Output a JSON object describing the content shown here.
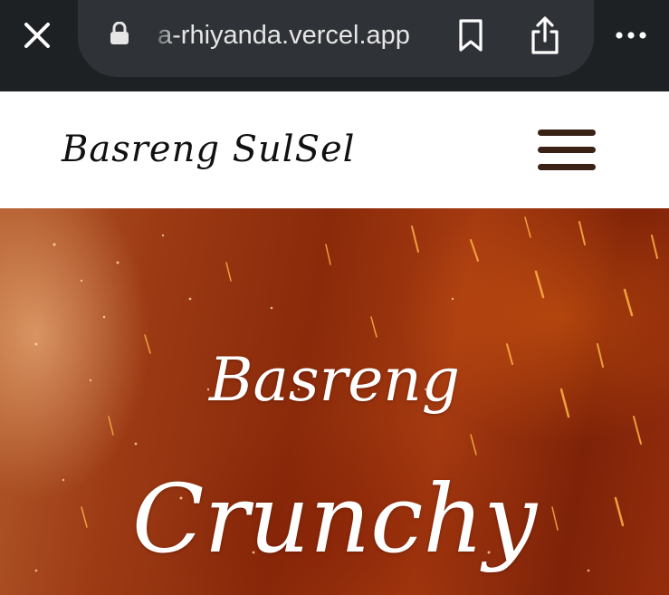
{
  "browser": {
    "url": "a-rhiyanda.vercel.app",
    "icons": {
      "close": "close-icon",
      "lock": "lock-icon",
      "bookmark": "bookmark-icon",
      "share": "share-icon",
      "more": "more-icon"
    },
    "bar_color": "#1e2124",
    "pill_color": "#2f3236"
  },
  "header": {
    "logo": "Basreng SulSel",
    "menu_icon": "hamburger-menu-icon",
    "menu_color": "#3a2216"
  },
  "hero": {
    "line1": "Basreng",
    "line2": "Crunchy",
    "background": "fiery-sparks-image"
  }
}
